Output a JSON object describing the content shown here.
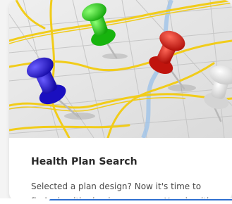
{
  "card": {
    "title": "Health Plan Search",
    "description": "Selected a plan design? Now it's time to find a health plan in your area. Your health",
    "image_icon": "map-with-pushpins"
  },
  "colors": {
    "accent": "#2f6fd0",
    "title": "#2a2a2a",
    "text": "#4a4a4a",
    "pin_blue": "#2016d8",
    "pin_green": "#29d81e",
    "pin_red": "#e5140f",
    "pin_white": "#eeeeee",
    "road_yellow": "#f1cc1a"
  }
}
